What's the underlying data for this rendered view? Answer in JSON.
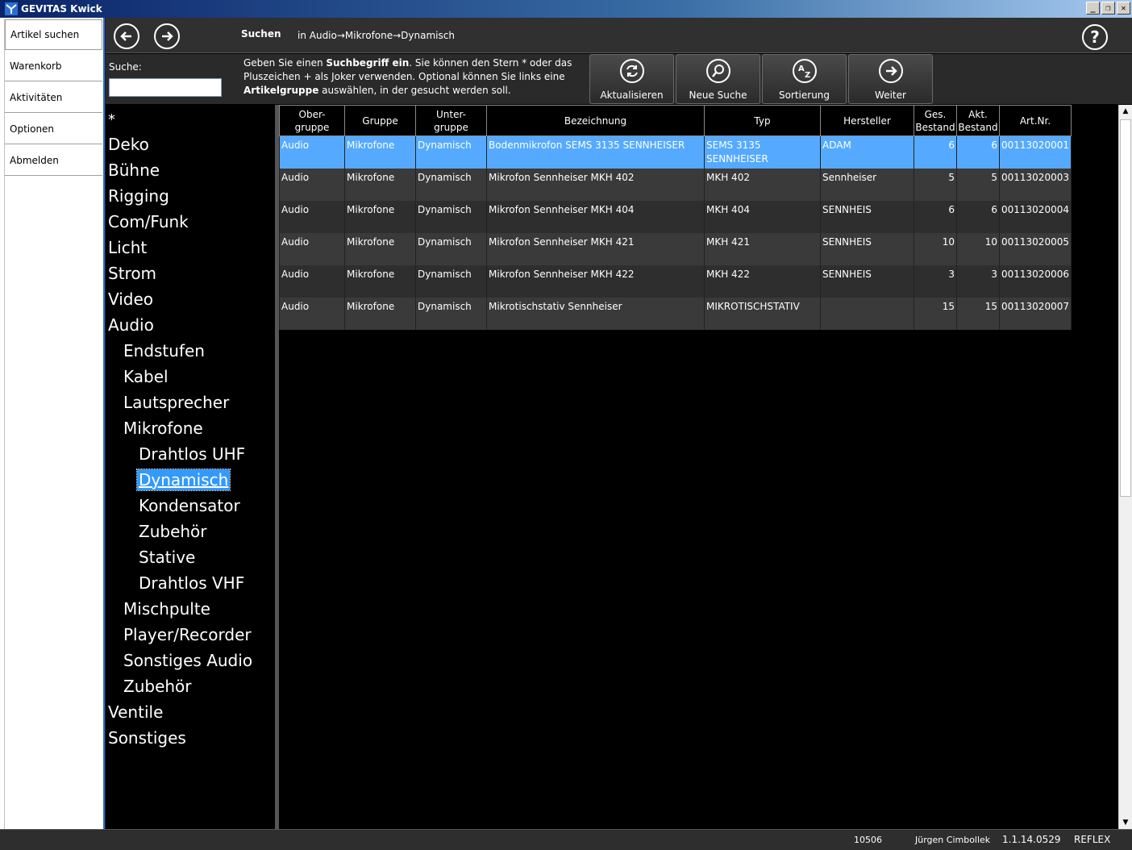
{
  "window": {
    "title": "GEVITAS Kwick",
    "min": "_",
    "restore": "❐",
    "close": "✕"
  },
  "nav": {
    "items": [
      {
        "label": "Artikel suchen"
      },
      {
        "label": "Warenkorb"
      },
      {
        "label": "Aktivitäten"
      },
      {
        "label": "Optionen"
      },
      {
        "label": "Abmelden"
      }
    ]
  },
  "topbar": {
    "title": "Suchen",
    "breadcrumb": "in Audio→Mikrofone→Dynamisch",
    "help": "?"
  },
  "search": {
    "label": "Suche:",
    "value": "",
    "hint_pre": "Geben Sie einen ",
    "hint_b1": "Suchbegriff ein",
    "hint_mid": ". Sie können den Stern * oder das Pluszeichen + als Joker verwenden. Optional können Sie links eine ",
    "hint_b2": "Artikelgruppe",
    "hint_post": " auswählen, in der gesucht werden soll."
  },
  "toolbar": {
    "refresh": "Aktualisieren",
    "new_search": "Neue Suche",
    "sort": "Sortierung",
    "next": "Weiter"
  },
  "tree": {
    "star": "*",
    "items": [
      {
        "label": "Deko",
        "level": 0
      },
      {
        "label": "Bühne",
        "level": 0
      },
      {
        "label": "Rigging",
        "level": 0
      },
      {
        "label": "Com/Funk",
        "level": 0
      },
      {
        "label": "Licht",
        "level": 0
      },
      {
        "label": "Strom",
        "level": 0
      },
      {
        "label": "Video",
        "level": 0
      },
      {
        "label": "Audio",
        "level": 0
      },
      {
        "label": "Endstufen",
        "level": 1
      },
      {
        "label": "Kabel",
        "level": 1
      },
      {
        "label": "Lautsprecher",
        "level": 1
      },
      {
        "label": "Mikrofone",
        "level": 1
      },
      {
        "label": "Drahtlos UHF",
        "level": 2
      },
      {
        "label": "Dynamisch",
        "level": 2,
        "selected": true
      },
      {
        "label": "Kondensator",
        "level": 2
      },
      {
        "label": "Zubehör",
        "level": 2
      },
      {
        "label": "Stative",
        "level": 2
      },
      {
        "label": "Drahtlos VHF",
        "level": 2
      },
      {
        "label": "Mischpulte",
        "level": 1
      },
      {
        "label": "Player/Recorder",
        "level": 1
      },
      {
        "label": "Sonstiges Audio",
        "level": 1
      },
      {
        "label": "Zubehör",
        "level": 1
      },
      {
        "label": "Ventile",
        "level": 0
      },
      {
        "label": "Sonstiges",
        "level": 0
      }
    ]
  },
  "table": {
    "columns": [
      {
        "label": "Ober-\ngruppe"
      },
      {
        "label": "Gruppe"
      },
      {
        "label": "Unter-\ngruppe"
      },
      {
        "label": "Bezeichnung"
      },
      {
        "label": "Typ"
      },
      {
        "label": "Hersteller"
      },
      {
        "label": "Ges.\nBestand"
      },
      {
        "label": "Akt.\nBestand"
      },
      {
        "label": "Art.Nr."
      }
    ],
    "rows": [
      [
        "Audio",
        "Mikrofone",
        "Dynamisch",
        "Bodenmikrofon SEMS 3135 SENNHEISER",
        "SEMS 3135 SENNHEISER",
        "ADAM",
        "6",
        "6",
        "00113020001"
      ],
      [
        "Audio",
        "Mikrofone",
        "Dynamisch",
        "Mikrofon Sennheiser MKH 402",
        "MKH 402",
        "Sennheiser",
        "5",
        "5",
        "00113020003"
      ],
      [
        "Audio",
        "Mikrofone",
        "Dynamisch",
        "Mikrofon Sennheiser MKH 404",
        "MKH 404",
        "SENNHEIS",
        "6",
        "6",
        "00113020004"
      ],
      [
        "Audio",
        "Mikrofone",
        "Dynamisch",
        "Mikrofon Sennheiser MKH 421",
        "MKH 421",
        "SENNHEIS",
        "10",
        "10",
        "00113020005"
      ],
      [
        "Audio",
        "Mikrofone",
        "Dynamisch",
        "Mikrofon Sennheiser MKH 422",
        "MKH 422",
        "SENNHEIS",
        "3",
        "3",
        "00113020006"
      ],
      [
        "Audio",
        "Mikrofone",
        "Dynamisch",
        "Mikrotischstativ Sennheiser",
        "MIKROTISCHSTATIV",
        "",
        "15",
        "15",
        "00113020007"
      ]
    ],
    "selected_row": 0
  },
  "status": {
    "code": "10506",
    "user": "Jürgen Cimbollek",
    "version": "1.1.14.0529",
    "db": "REFLEX"
  }
}
